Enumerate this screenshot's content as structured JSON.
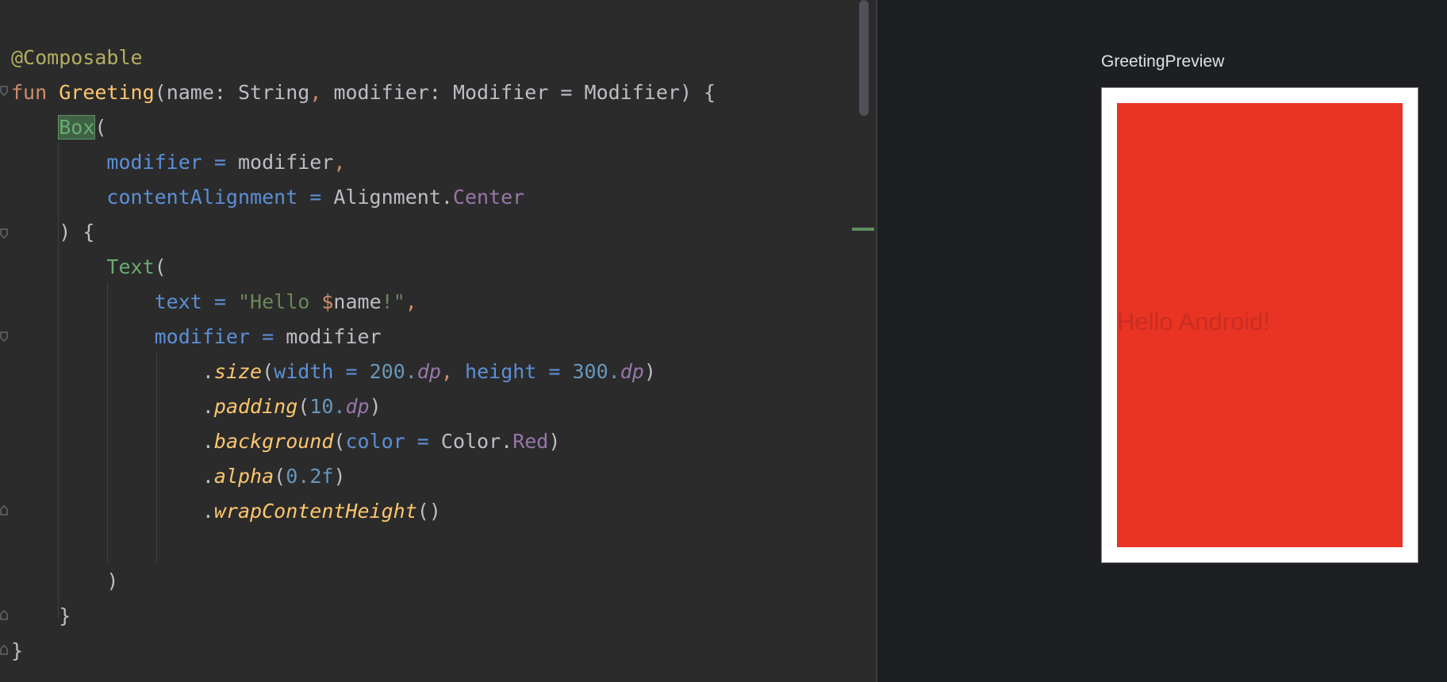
{
  "editor": {
    "code": {
      "l1_annotation": "@Composable",
      "l2_fun": "fun",
      "l2_name": "Greeting",
      "l2_paren_open": "(",
      "l2_p1": "name: String",
      "l2_comma": ",",
      "l2_p2": " modifier: Modifier = Modifier",
      "l2_close": ") {",
      "l3_box": "Box",
      "l3_paren": "(",
      "l4_param": "modifier",
      "l4_eq": " = ",
      "l4_val": "modifier",
      "l4_comma": ",",
      "l5_param": "contentAlignment",
      "l5_eq": " = ",
      "l5_obj": "Alignment.",
      "l5_member": "Center",
      "l6_text": ") {",
      "l7_call": "Text",
      "l7_paren": "(",
      "l8_param": "text",
      "l8_eq": " = ",
      "l8_str1": "\"Hello ",
      "l8_esc": "$",
      "l8_var": "name",
      "l8_str2": "!\"",
      "l8_comma": ",",
      "l9_param": "modifier",
      "l9_eq": " = ",
      "l9_val": "modifier",
      "l10_dot": ".",
      "l10_fn": "size",
      "l10_open": "(",
      "l10_p1": "width",
      "l10_eq1": " = ",
      "l10_n1": "200.",
      "l10_u1": "dp",
      "l10_comma": ",",
      "l10_p2": " height",
      "l10_eq2": " = ",
      "l10_n2": "300.",
      "l10_u2": "dp",
      "l10_close": ")",
      "l11_dot": ".",
      "l11_fn": "padding",
      "l11_open": "(",
      "l11_n": "10.",
      "l11_u": "dp",
      "l11_close": ")",
      "l12_dot": ".",
      "l12_fn": "background",
      "l12_open": "(",
      "l12_param": "color",
      "l12_eq": " = ",
      "l12_obj": "Color.",
      "l12_member": "Red",
      "l12_close": ")",
      "l13_dot": ".",
      "l13_fn": "alpha",
      "l13_open": "(",
      "l13_n": "0.2f",
      "l13_close": ")",
      "l14_dot": ".",
      "l14_fn": "wrapContentHeight",
      "l14_parens": "()",
      "l16_text": ")",
      "l17_text": "}",
      "l18_text": "}"
    }
  },
  "preview": {
    "title": "GreetingPreview",
    "hello_text": "Hello Android!",
    "box_color": "#e93323"
  }
}
